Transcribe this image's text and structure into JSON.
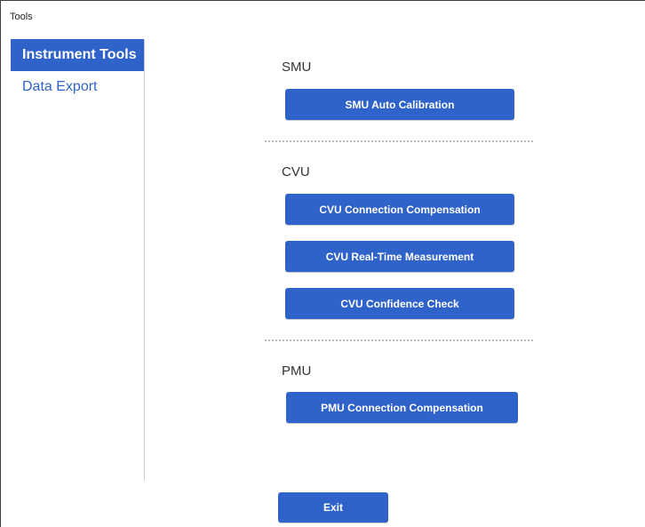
{
  "window": {
    "title": "Tools"
  },
  "sidebar": {
    "items": [
      {
        "label": "Instrument Tools",
        "active": true
      },
      {
        "label": "Data Export",
        "active": false
      }
    ]
  },
  "sections": {
    "smu": {
      "label": "SMU",
      "buttons": [
        "SMU Auto Calibration"
      ]
    },
    "cvu": {
      "label": "CVU",
      "buttons": [
        "CVU Connection Compensation",
        "CVU Real-Time Measurement",
        "CVU Confidence Check"
      ]
    },
    "pmu": {
      "label": "PMU",
      "buttons": [
        "PMU Connection Compensation"
      ]
    }
  },
  "footer": {
    "exit_label": "Exit"
  },
  "colors": {
    "accent": "#2f63c9",
    "text": "#333333",
    "divider": "#b7bcc4"
  }
}
